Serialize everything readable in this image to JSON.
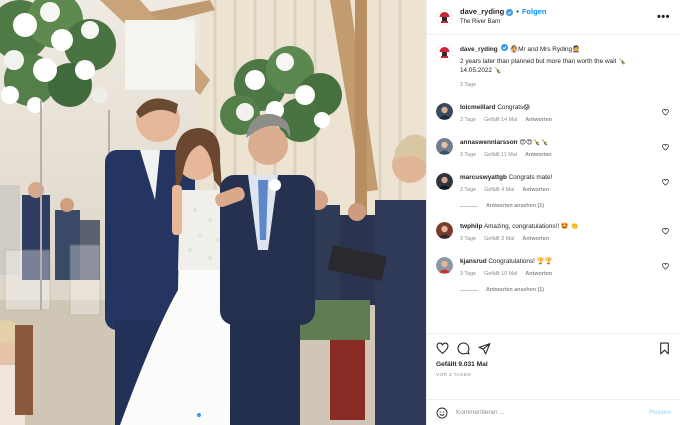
{
  "header": {
    "username": "dave_ryding",
    "follow_label": "Folgen",
    "separator": "•",
    "location": "The River Barn",
    "more_label": "•••"
  },
  "caption": {
    "username": "dave_ryding",
    "line1": "👰Mr and Mrs Ryding🤵",
    "line2": "2 years later than planned but more than worth the wait 🍾",
    "line3": "14.05.2022 🍾",
    "time": "3 Tage"
  },
  "comments": [
    {
      "username": "loicmeillard",
      "text": "Congrats😱",
      "time": "3 Tage",
      "likes": "Gefällt 14 Mal",
      "reply": "Antworten",
      "avatar_color": "#3a4a5e"
    },
    {
      "username": "annaswennlarsson",
      "text": "😍😍🍾🍾",
      "time": "3 Tage",
      "likes": "Gefällt 11 Mal",
      "reply": "Antworten",
      "avatar_color": "#6f7d8c"
    },
    {
      "username": "marcuswyattgb",
      "text": "Congrats mate!",
      "time": "3 Tage",
      "likes": "Gefällt 4 Mal",
      "reply": "Antworten",
      "avatar_color": "#2c3540",
      "replies": "Antworten ansehen (1)"
    },
    {
      "username": "twphilp",
      "text": "Amazing, congratulations!! 🤩 👏",
      "time": "3 Tage",
      "likes": "Gefällt 3 Mal",
      "reply": "Antworten",
      "avatar_color": "#7a3b2e"
    },
    {
      "username": "kjansrud",
      "text": "Congratulations! 🏆🏆",
      "time": "3 Tage",
      "likes": "Gefällt 10 Mal",
      "reply": "Antworten",
      "avatar_color": "#8b97a3",
      "replies": "Antworten ansehen (1)"
    }
  ],
  "actions": {
    "likes": "Gefällt 9.031 Mal",
    "ago": "VOR 3 TAGEN",
    "comment_placeholder": "Kommentieren ...",
    "post_label": "Posten"
  },
  "colors": {
    "accent": "#0095f6",
    "verified": "#3897f0",
    "post_disabled": "#b2dffc",
    "muted": "#8e8e8e"
  },
  "photo": {
    "carousel_total": 5,
    "carousel_active": 1
  }
}
